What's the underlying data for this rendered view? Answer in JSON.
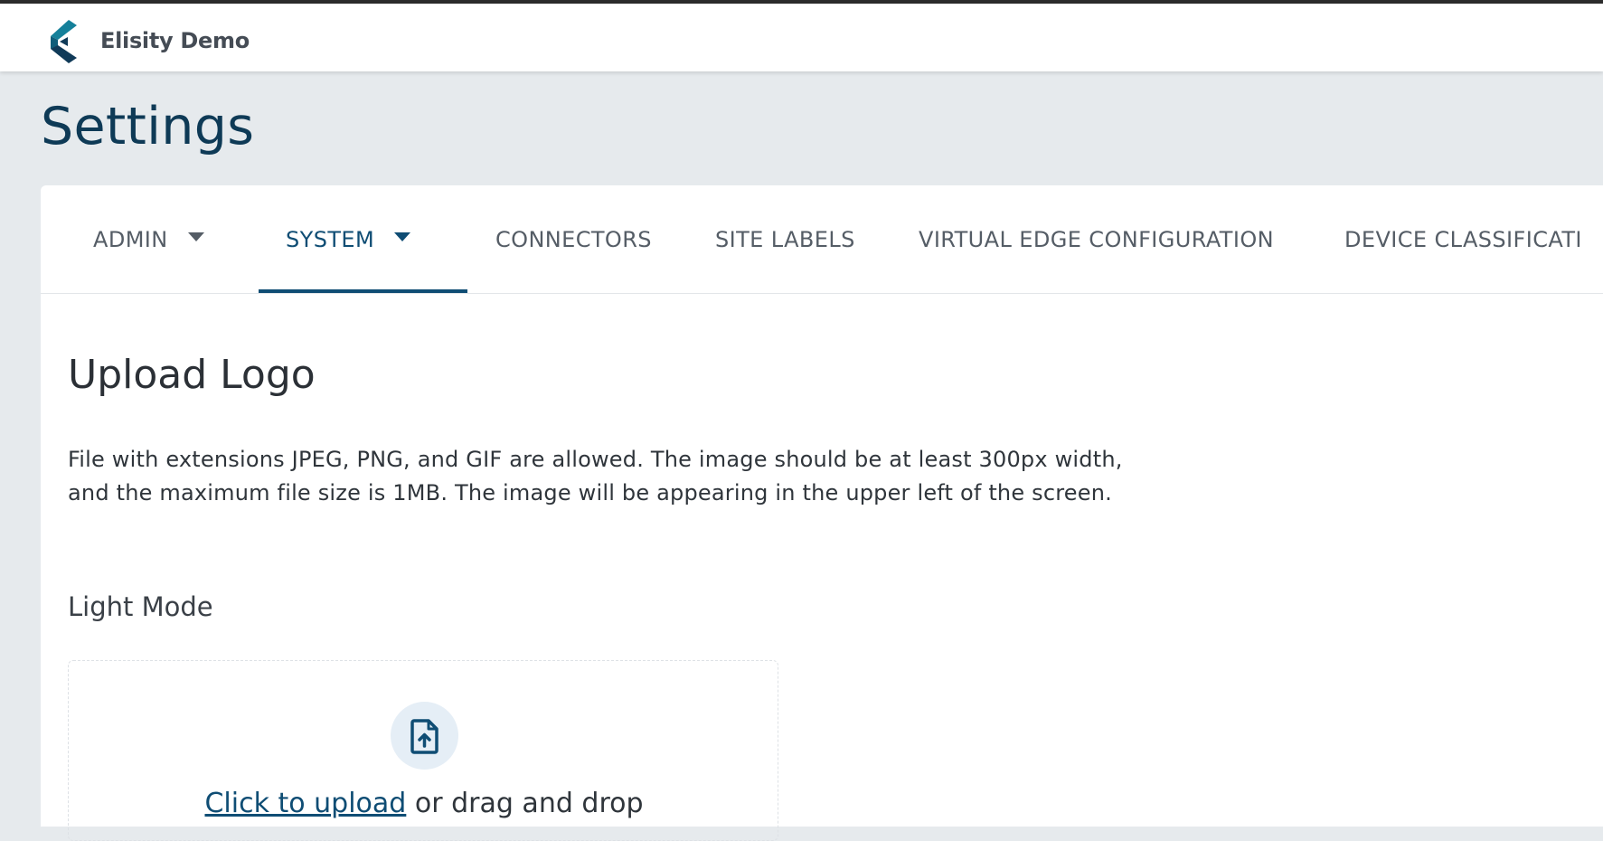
{
  "app": {
    "name": "Elisity Demo"
  },
  "page": {
    "title": "Settings"
  },
  "tabs": [
    {
      "label": "ADMIN",
      "has_dropdown": true,
      "active": false
    },
    {
      "label": "SYSTEM",
      "has_dropdown": true,
      "active": true
    },
    {
      "label": "CONNECTORS",
      "has_dropdown": false,
      "active": false
    },
    {
      "label": "SITE LABELS",
      "has_dropdown": false,
      "active": false
    },
    {
      "label": "VIRTUAL EDGE CONFIGURATION",
      "has_dropdown": false,
      "active": false
    },
    {
      "label": "DEVICE CLASSIFICATI",
      "has_dropdown": false,
      "active": false
    }
  ],
  "upload_logo": {
    "title": "Upload Logo",
    "description_line1": "File with extensions JPEG, PNG, and GIF are allowed. The image should be at least 300px width,",
    "description_line2": "and the maximum file size is 1MB. The image will be appearing in the upper left of the screen.",
    "light_mode_label": "Light Mode",
    "dropzone": {
      "link_text": "Click to upload",
      "rest_text": " or drag and drop",
      "icon": "file-upload-icon"
    }
  },
  "icons": {
    "logo": "elisity-logo-icon",
    "caret": "caret-down-icon"
  },
  "colors": {
    "primary": "#0f4d74",
    "brand_teal": "#15809a",
    "brand_navy": "#103a58",
    "page_background": "#e6eaed",
    "header_background": "#ffffff"
  }
}
